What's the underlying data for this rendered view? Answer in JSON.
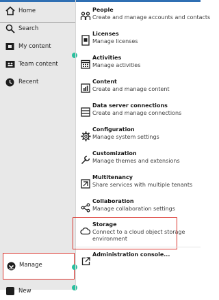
{
  "sidebar": {
    "items": [
      {
        "label": "Home",
        "icon": "home-icon"
      },
      {
        "label": "Search",
        "icon": "search-icon"
      },
      {
        "label": "My content",
        "icon": "folder-icon"
      },
      {
        "label": "Team content",
        "icon": "team-folder-icon"
      },
      {
        "label": "Recent",
        "icon": "clock-icon"
      }
    ],
    "manage": {
      "label": "Manage",
      "icon": "manage-icon"
    },
    "new": {
      "label": "New"
    }
  },
  "menu": {
    "items": [
      {
        "title": "People",
        "desc": "Create and manage accounts and contacts",
        "icon": "people-icon"
      },
      {
        "title": "Licenses",
        "desc": "Manage licenses",
        "icon": "license-icon"
      },
      {
        "title": "Activities",
        "desc": "Manage activities",
        "icon": "calendar-icon"
      },
      {
        "title": "Content",
        "desc": "Create and manage content",
        "icon": "content-chart-icon"
      },
      {
        "title": "Data server connections",
        "desc": "Create and manage connections",
        "icon": "data-server-icon"
      },
      {
        "title": "Configuration",
        "desc": "Manage system settings",
        "icon": "gear-icon"
      },
      {
        "title": "Customization",
        "desc": "Manage themes and extensions",
        "icon": "wrench-icon"
      },
      {
        "title": "Multitenancy",
        "desc": "Share services with multiple tenants",
        "icon": "multitenancy-icon"
      },
      {
        "title": "Collaboration",
        "desc": "Manage collaboration settings",
        "icon": "share-icon"
      },
      {
        "title": "Storage",
        "desc": "Connect to a cloud object storage",
        "desc2": "environment",
        "icon": "cloud-icon"
      },
      {
        "title": "Administration console...",
        "desc": "",
        "icon": "external-link-icon"
      }
    ]
  },
  "colors": {
    "accent": "#2f6fb3",
    "highlight": "#d9322b",
    "status_dot": "#2abf9e",
    "sidebar_bg": "#e8e8e8"
  }
}
